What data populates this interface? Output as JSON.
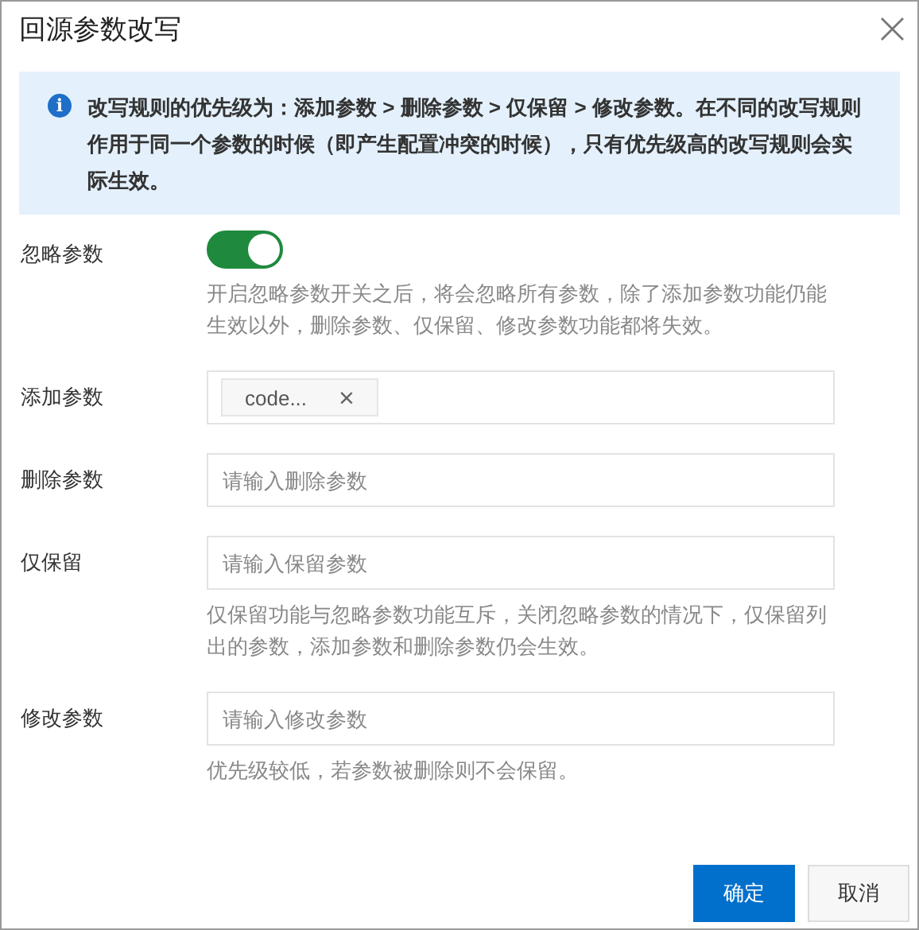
{
  "dialog": {
    "title": "回源参数改写",
    "close": "×"
  },
  "notice": {
    "icon": "i",
    "text": "改写规则的优先级为：添加参数 > 删除参数 > 仅保留 > 修改参数。在不同的改写规则作用于同一个参数的时候（即产生配置冲突的时候），只有优先级高的改写规则会实际生效。"
  },
  "rows": [
    {
      "kind": "switch",
      "label": "忽略参数",
      "on": true,
      "hint": "开启忽略参数开关之后，将会忽略所有参数，除了添加参数功能仍能生效以外，删除参数、仅保留、修改参数功能都将失效。"
    },
    {
      "kind": "tags",
      "label": "添加参数",
      "tags": [
        {
          "text": "code...",
          "remove": "×"
        }
      ]
    },
    {
      "kind": "input",
      "label": "删除参数",
      "placeholder": "请输入删除参数"
    },
    {
      "kind": "input",
      "label": "仅保留",
      "placeholder": "请输入保留参数",
      "hint": "仅保留功能与忽略参数功能互斥，关闭忽略参数的情况下，仅保留列出的参数，添加参数和删除参数仍会生效。"
    },
    {
      "kind": "input",
      "label": "修改参数",
      "placeholder": "请输入修改参数",
      "hint": "优先级较低，若参数被删除则不会保留。"
    }
  ],
  "buttons": [
    {
      "label": "确定",
      "kind": "primary"
    },
    {
      "label": "取消",
      "kind": "secondary"
    }
  ]
}
